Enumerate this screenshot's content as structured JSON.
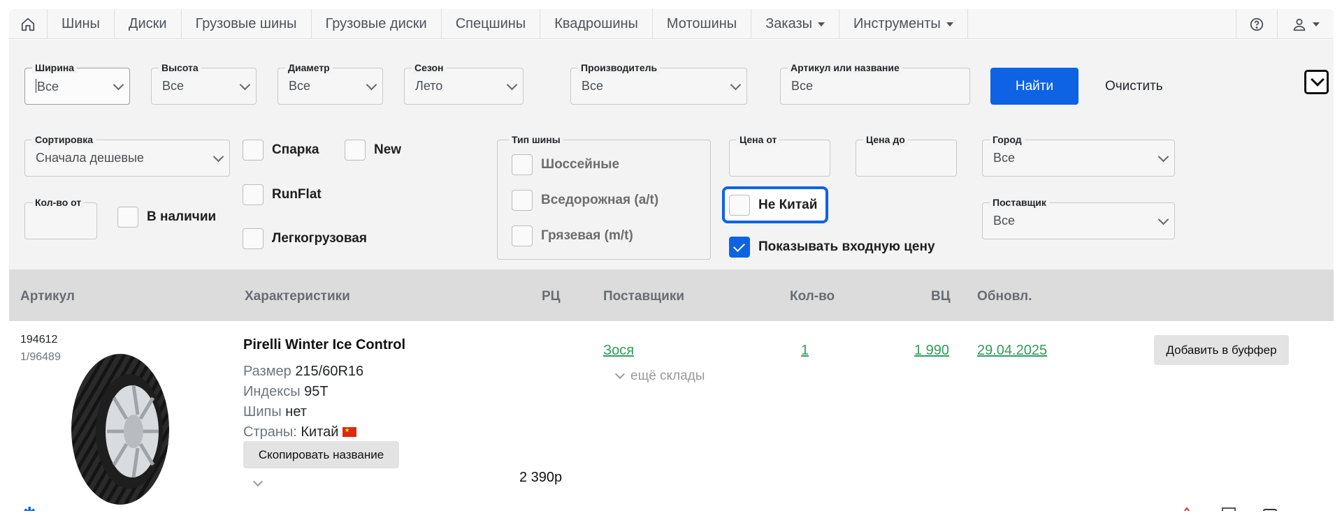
{
  "nav": {
    "items": [
      "Шины",
      "Диски",
      "Грузовые шины",
      "Грузовые диски",
      "Спецшины",
      "Квадрошины",
      "Мотошины"
    ],
    "dropdowns": [
      "Заказы",
      "Инструменты"
    ]
  },
  "filters": {
    "width": {
      "label": "Ширина",
      "value": "Все"
    },
    "height": {
      "label": "Высота",
      "value": "Все"
    },
    "diameter": {
      "label": "Диаметр",
      "value": "Все"
    },
    "season": {
      "label": "Сезон",
      "value": "Лето"
    },
    "manufacturer": {
      "label": "Производитель",
      "value": "Все"
    },
    "article": {
      "label": "Артикул или название",
      "placeholder": "Все"
    },
    "find_button": "Найти",
    "clear_button": "Очистить",
    "sort": {
      "label": "Сортировка",
      "value": "Сначала дешевые"
    },
    "qty_from": {
      "label": "Кол-во от",
      "value": ""
    },
    "in_stock": {
      "label": "В наличии",
      "checked": false
    },
    "sparka": {
      "label": "Спарка",
      "checked": false
    },
    "new": {
      "label": "New",
      "checked": false
    },
    "runflat": {
      "label": "RunFlat",
      "checked": false
    },
    "light_truck": {
      "label": "Легкогрузовая",
      "checked": false
    },
    "tire_type": {
      "label": "Тип шины",
      "options": [
        {
          "label": "Шоссейные",
          "checked": false
        },
        {
          "label": "Вседорожная (a/t)",
          "checked": false
        },
        {
          "label": "Грязевая (m/t)",
          "checked": false
        }
      ]
    },
    "price_from": {
      "label": "Цена от",
      "value": ""
    },
    "price_to": {
      "label": "Цена до",
      "value": ""
    },
    "not_china": {
      "label": "Не Китай",
      "checked": false
    },
    "show_input_price": {
      "label": "Показывать входную цену",
      "checked": true
    },
    "city": {
      "label": "Город",
      "value": "Все"
    },
    "supplier": {
      "label": "Поставщик",
      "value": "Все"
    }
  },
  "table": {
    "headers": {
      "article": "Артикул",
      "characteristics": "Характеристики",
      "rc": "РЦ",
      "suppliers": "Поставщики",
      "qty": "Кол-во",
      "vc": "ВЦ",
      "updated": "Обновл."
    },
    "rows": [
      {
        "sku": "194612",
        "sku2": "1/96489",
        "name": "Pirelli Winter Ice Control",
        "size_label": "Размер",
        "size": "215/60R16",
        "index_label": "Индексы",
        "index": "95T",
        "studs_label": "Шипы",
        "studs": "нет",
        "country_label": "Страны:",
        "country": "Китай",
        "copy_button": "Скопировать название",
        "rc_price": "2 390р",
        "supplier": "Зося",
        "more_warehouses": "ещё склады",
        "qty": "1",
        "vc": "1 990",
        "updated": "29.04.2025",
        "buffer_button": "Добавить в буффер"
      }
    ]
  },
  "colors": {
    "accent": "#0d63e4",
    "link": "#2f9e5b",
    "header_bg": "#dcdcdc",
    "panel_bg": "#f3f3f3"
  },
  "icons": [
    "home-icon",
    "help-icon",
    "user-icon",
    "chevron-down-icon",
    "snowflake-icon",
    "warning-icon",
    "calculator-icon",
    "camera-icon"
  ]
}
